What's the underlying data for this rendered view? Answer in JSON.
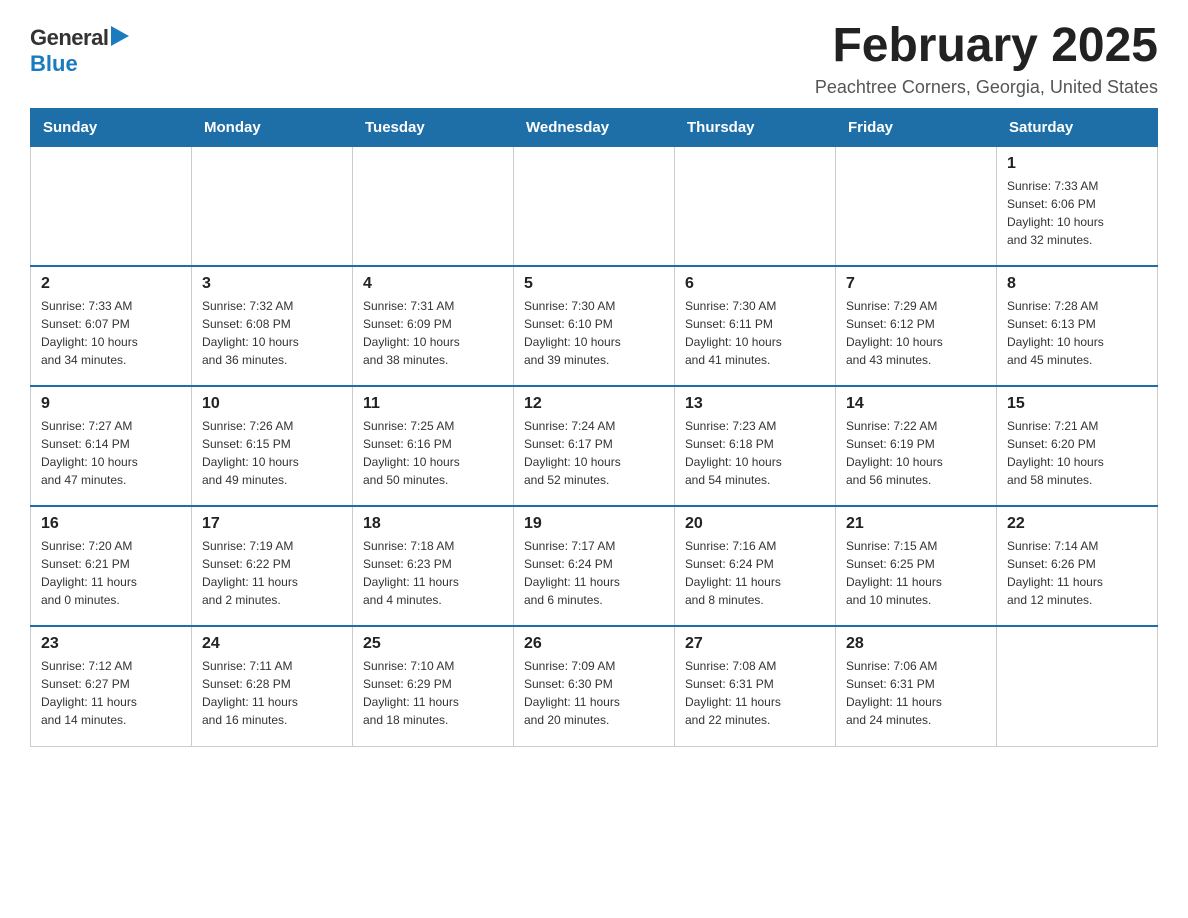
{
  "logo": {
    "general": "General",
    "blue": "Blue",
    "arrow": "▶"
  },
  "title": "February 2025",
  "location": "Peachtree Corners, Georgia, United States",
  "weekdays": [
    "Sunday",
    "Monday",
    "Tuesday",
    "Wednesday",
    "Thursday",
    "Friday",
    "Saturday"
  ],
  "weeks": [
    [
      {
        "day": "",
        "info": ""
      },
      {
        "day": "",
        "info": ""
      },
      {
        "day": "",
        "info": ""
      },
      {
        "day": "",
        "info": ""
      },
      {
        "day": "",
        "info": ""
      },
      {
        "day": "",
        "info": ""
      },
      {
        "day": "1",
        "info": "Sunrise: 7:33 AM\nSunset: 6:06 PM\nDaylight: 10 hours\nand 32 minutes."
      }
    ],
    [
      {
        "day": "2",
        "info": "Sunrise: 7:33 AM\nSunset: 6:07 PM\nDaylight: 10 hours\nand 34 minutes."
      },
      {
        "day": "3",
        "info": "Sunrise: 7:32 AM\nSunset: 6:08 PM\nDaylight: 10 hours\nand 36 minutes."
      },
      {
        "day": "4",
        "info": "Sunrise: 7:31 AM\nSunset: 6:09 PM\nDaylight: 10 hours\nand 38 minutes."
      },
      {
        "day": "5",
        "info": "Sunrise: 7:30 AM\nSunset: 6:10 PM\nDaylight: 10 hours\nand 39 minutes."
      },
      {
        "day": "6",
        "info": "Sunrise: 7:30 AM\nSunset: 6:11 PM\nDaylight: 10 hours\nand 41 minutes."
      },
      {
        "day": "7",
        "info": "Sunrise: 7:29 AM\nSunset: 6:12 PM\nDaylight: 10 hours\nand 43 minutes."
      },
      {
        "day": "8",
        "info": "Sunrise: 7:28 AM\nSunset: 6:13 PM\nDaylight: 10 hours\nand 45 minutes."
      }
    ],
    [
      {
        "day": "9",
        "info": "Sunrise: 7:27 AM\nSunset: 6:14 PM\nDaylight: 10 hours\nand 47 minutes."
      },
      {
        "day": "10",
        "info": "Sunrise: 7:26 AM\nSunset: 6:15 PM\nDaylight: 10 hours\nand 49 minutes."
      },
      {
        "day": "11",
        "info": "Sunrise: 7:25 AM\nSunset: 6:16 PM\nDaylight: 10 hours\nand 50 minutes."
      },
      {
        "day": "12",
        "info": "Sunrise: 7:24 AM\nSunset: 6:17 PM\nDaylight: 10 hours\nand 52 minutes."
      },
      {
        "day": "13",
        "info": "Sunrise: 7:23 AM\nSunset: 6:18 PM\nDaylight: 10 hours\nand 54 minutes."
      },
      {
        "day": "14",
        "info": "Sunrise: 7:22 AM\nSunset: 6:19 PM\nDaylight: 10 hours\nand 56 minutes."
      },
      {
        "day": "15",
        "info": "Sunrise: 7:21 AM\nSunset: 6:20 PM\nDaylight: 10 hours\nand 58 minutes."
      }
    ],
    [
      {
        "day": "16",
        "info": "Sunrise: 7:20 AM\nSunset: 6:21 PM\nDaylight: 11 hours\nand 0 minutes."
      },
      {
        "day": "17",
        "info": "Sunrise: 7:19 AM\nSunset: 6:22 PM\nDaylight: 11 hours\nand 2 minutes."
      },
      {
        "day": "18",
        "info": "Sunrise: 7:18 AM\nSunset: 6:23 PM\nDaylight: 11 hours\nand 4 minutes."
      },
      {
        "day": "19",
        "info": "Sunrise: 7:17 AM\nSunset: 6:24 PM\nDaylight: 11 hours\nand 6 minutes."
      },
      {
        "day": "20",
        "info": "Sunrise: 7:16 AM\nSunset: 6:24 PM\nDaylight: 11 hours\nand 8 minutes."
      },
      {
        "day": "21",
        "info": "Sunrise: 7:15 AM\nSunset: 6:25 PM\nDaylight: 11 hours\nand 10 minutes."
      },
      {
        "day": "22",
        "info": "Sunrise: 7:14 AM\nSunset: 6:26 PM\nDaylight: 11 hours\nand 12 minutes."
      }
    ],
    [
      {
        "day": "23",
        "info": "Sunrise: 7:12 AM\nSunset: 6:27 PM\nDaylight: 11 hours\nand 14 minutes."
      },
      {
        "day": "24",
        "info": "Sunrise: 7:11 AM\nSunset: 6:28 PM\nDaylight: 11 hours\nand 16 minutes."
      },
      {
        "day": "25",
        "info": "Sunrise: 7:10 AM\nSunset: 6:29 PM\nDaylight: 11 hours\nand 18 minutes."
      },
      {
        "day": "26",
        "info": "Sunrise: 7:09 AM\nSunset: 6:30 PM\nDaylight: 11 hours\nand 20 minutes."
      },
      {
        "day": "27",
        "info": "Sunrise: 7:08 AM\nSunset: 6:31 PM\nDaylight: 11 hours\nand 22 minutes."
      },
      {
        "day": "28",
        "info": "Sunrise: 7:06 AM\nSunset: 6:31 PM\nDaylight: 11 hours\nand 24 minutes."
      },
      {
        "day": "",
        "info": ""
      }
    ]
  ]
}
